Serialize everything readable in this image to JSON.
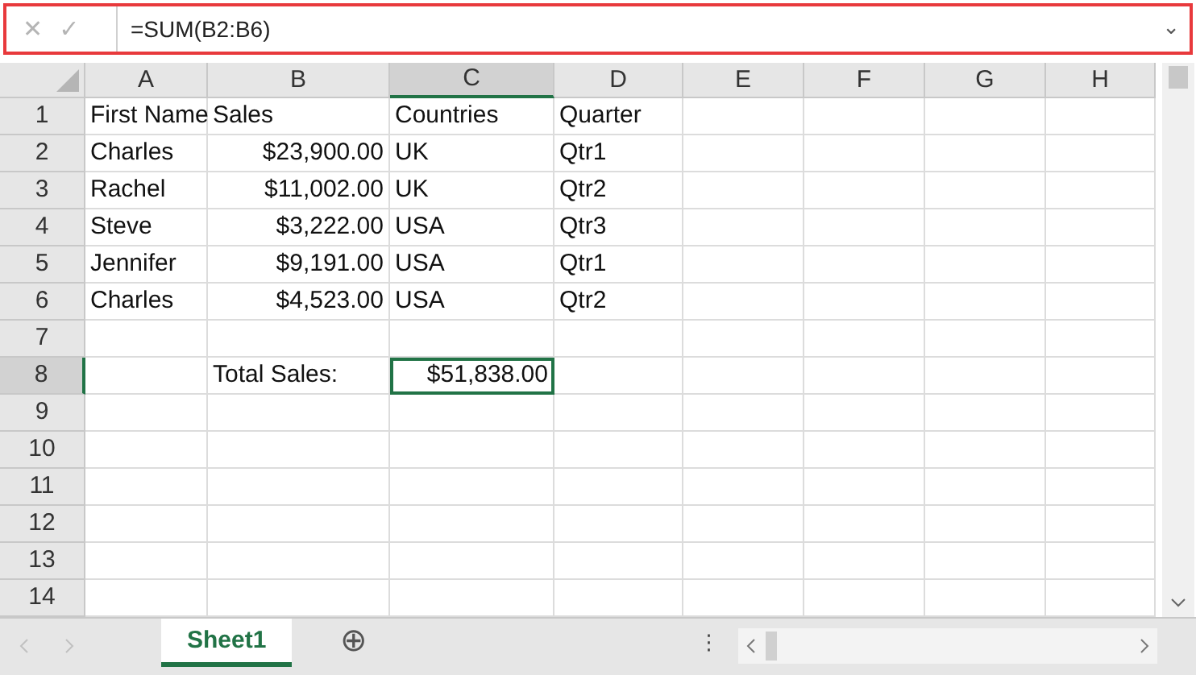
{
  "formula_bar": {
    "cancel": "✕",
    "enter": "✓",
    "formula": "=SUM(B2:B6)",
    "expand": "⌄"
  },
  "columns": [
    {
      "label": "A",
      "selected": false
    },
    {
      "label": "B",
      "selected": false
    },
    {
      "label": "C",
      "selected": true
    },
    {
      "label": "D",
      "selected": false
    },
    {
      "label": "E",
      "selected": false
    },
    {
      "label": "F",
      "selected": false
    },
    {
      "label": "G",
      "selected": false
    },
    {
      "label": "H",
      "selected": false
    }
  ],
  "rows": [
    {
      "header": "1",
      "selected": false,
      "cells": [
        {
          "text": "First Name",
          "kind": "text"
        },
        {
          "text": "Sales",
          "kind": "text"
        },
        {
          "text": "Countries",
          "kind": "text"
        },
        {
          "text": "Quarter",
          "kind": "text"
        },
        null,
        null,
        null,
        null
      ]
    },
    {
      "header": "2",
      "selected": false,
      "cells": [
        {
          "text": "Charles",
          "kind": "text"
        },
        {
          "text": "$23,900.00",
          "kind": "number"
        },
        {
          "text": "UK",
          "kind": "text"
        },
        {
          "text": "Qtr1",
          "kind": "text"
        },
        null,
        null,
        null,
        null
      ]
    },
    {
      "header": "3",
      "selected": false,
      "cells": [
        {
          "text": "Rachel",
          "kind": "text"
        },
        {
          "text": "$11,002.00",
          "kind": "number"
        },
        {
          "text": "UK",
          "kind": "text"
        },
        {
          "text": "Qtr2",
          "kind": "text"
        },
        null,
        null,
        null,
        null
      ]
    },
    {
      "header": "4",
      "selected": false,
      "cells": [
        {
          "text": "Steve",
          "kind": "text"
        },
        {
          "text": "$3,222.00",
          "kind": "number"
        },
        {
          "text": "USA",
          "kind": "text"
        },
        {
          "text": "Qtr3",
          "kind": "text"
        },
        null,
        null,
        null,
        null
      ]
    },
    {
      "header": "5",
      "selected": false,
      "cells": [
        {
          "text": "Jennifer",
          "kind": "text"
        },
        {
          "text": "$9,191.00",
          "kind": "number"
        },
        {
          "text": "USA",
          "kind": "text"
        },
        {
          "text": "Qtr1",
          "kind": "text"
        },
        null,
        null,
        null,
        null
      ]
    },
    {
      "header": "6",
      "selected": false,
      "cells": [
        {
          "text": "Charles",
          "kind": "text"
        },
        {
          "text": "$4,523.00",
          "kind": "number"
        },
        {
          "text": "USA",
          "kind": "text"
        },
        {
          "text": "Qtr2",
          "kind": "text"
        },
        null,
        null,
        null,
        null
      ]
    },
    {
      "header": "7",
      "selected": false,
      "cells": [
        null,
        null,
        null,
        null,
        null,
        null,
        null,
        null
      ]
    },
    {
      "header": "8",
      "selected": true,
      "cells": [
        null,
        {
          "text": "Total Sales:",
          "kind": "text",
          "selected": false
        },
        {
          "text": "$51,838.00",
          "kind": "number",
          "selected": true
        },
        null,
        null,
        null,
        null,
        null
      ]
    },
    {
      "header": "9",
      "selected": false,
      "cells": [
        null,
        null,
        null,
        null,
        null,
        null,
        null,
        null
      ]
    },
    {
      "header": "10",
      "selected": false,
      "cells": [
        null,
        null,
        null,
        null,
        null,
        null,
        null,
        null
      ]
    },
    {
      "header": "11",
      "selected": false,
      "cells": [
        null,
        null,
        null,
        null,
        null,
        null,
        null,
        null
      ]
    },
    {
      "header": "12",
      "selected": false,
      "cells": [
        null,
        null,
        null,
        null,
        null,
        null,
        null,
        null
      ]
    },
    {
      "header": "13",
      "selected": false,
      "cells": [
        null,
        null,
        null,
        null,
        null,
        null,
        null,
        null
      ]
    },
    {
      "header": "14",
      "selected": false,
      "cells": [
        null,
        null,
        null,
        null,
        null,
        null,
        null,
        null
      ]
    }
  ],
  "sheet_tabs": [
    {
      "label": "Sheet1",
      "selected": true
    }
  ],
  "add_sheet": "⊕",
  "more_options": "⋮"
}
